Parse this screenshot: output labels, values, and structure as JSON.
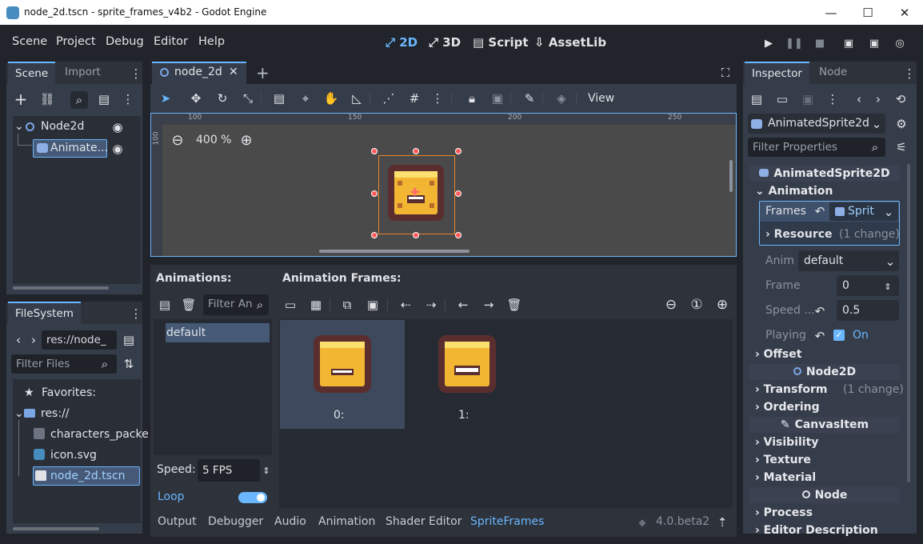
{
  "window": {
    "title": "node_2d.tscn - sprite_frames_v4b2 - Godot Engine",
    "minimize": "—",
    "maximize": "☐",
    "close": "✕"
  },
  "menu": [
    "Scene",
    "Project",
    "Debug",
    "Editor",
    "Help"
  ],
  "workspaces": [
    "2D",
    "3D",
    "Script",
    "AssetLib"
  ],
  "active_workspace": "2D",
  "scene_dock": {
    "tabs": [
      "Scene",
      "Import"
    ],
    "root": "Node2d",
    "child": "Animate..."
  },
  "filesystem": {
    "title": "FileSystem",
    "path": "res://node_",
    "filter": "Filter Files",
    "favorites": "Favorites:",
    "root": "res://",
    "files": [
      "characters_packe",
      "icon.svg",
      "node_2d.tscn"
    ],
    "selected": "node_2d.tscn"
  },
  "editor": {
    "tab": "node_2d",
    "close": "✕",
    "add": "+",
    "view": "View",
    "zoom": "400 %",
    "rulers": [
      "100",
      "150",
      "200",
      "250"
    ],
    "ruler_v": "100"
  },
  "spriteframes": {
    "animations_label": "Animations:",
    "filter": "Filter An",
    "animation_item": "default",
    "frames_label": "Animation Frames:",
    "frames": [
      "0:",
      "1:"
    ],
    "speed_label": "Speed:",
    "speed_value": "5 FPS",
    "loop_label": "Loop",
    "loop_on": true
  },
  "bottom_tabs": [
    "Output",
    "Debugger",
    "Audio",
    "Animation",
    "Shader Editor",
    "SpriteFrames"
  ],
  "active_bottom_tab": "SpriteFrames",
  "version": "4.0.beta2",
  "inspector": {
    "tabs": [
      "Inspector",
      "Node"
    ],
    "object": "AnimatedSprite2d",
    "filter": "Filter Properties",
    "class_header": "AnimatedSprite2D",
    "animation_section": "Animation",
    "frames_label": "Frames",
    "frames_value": "Sprit",
    "resource_label": "Resource",
    "resource_change": "(1 change)",
    "anim_label": "Anim",
    "anim_value": "default",
    "frame_label": "Frame",
    "frame_value": "0",
    "speed_label": "Speed ...",
    "speed_value": "0.5",
    "playing_label": "Playing",
    "playing_value": "On",
    "offset": "Offset",
    "node2d": "Node2D",
    "transform": "Transform",
    "transform_change": "(1 change)",
    "ordering": "Ordering",
    "canvasitem": "CanvasItem",
    "visibility": "Visibility",
    "texture": "Texture",
    "material": "Material",
    "node": "Node",
    "process": "Process",
    "editor_desc": "Editor Description"
  },
  "colors": {
    "accent": "#6ab7ff",
    "bg": "#21252b",
    "panel": "#2d323b",
    "sprite": "#f2b632",
    "selection_box": "#e8842c"
  }
}
